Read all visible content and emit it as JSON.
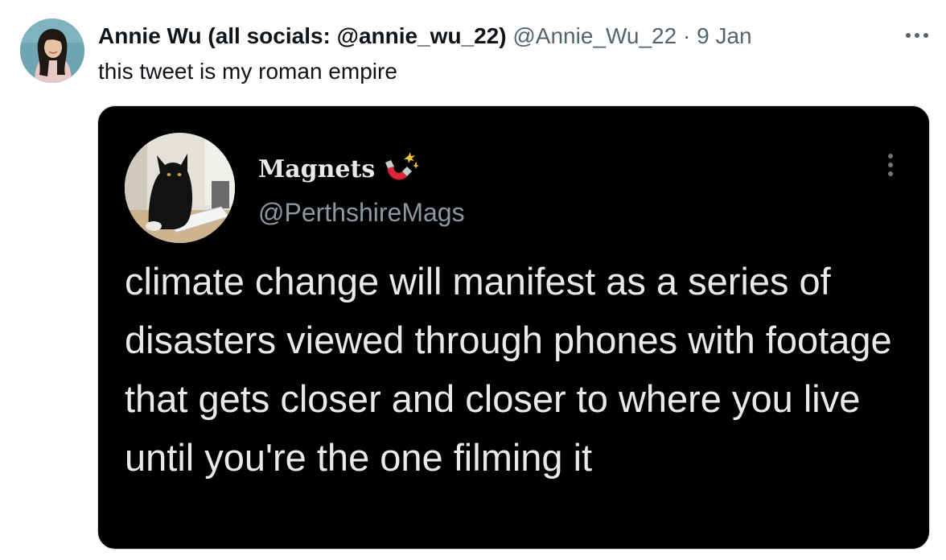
{
  "tweet": {
    "display_name": "Annie Wu (all socials: @annie_wu_22)",
    "handle": "@Annie_Wu_22",
    "separator": "·",
    "date": "9 Jan",
    "text": "this tweet is my roman empire",
    "more_icon": "more-horizontal-icon"
  },
  "quoted": {
    "display_name": "Magnets",
    "emoji_icon": "magnet-icon",
    "handle": "@PerthshireMags",
    "text": "climate change will manifest as a series of disasters viewed through phones with footage that gets closer and closer to where you live until you're the one filming it",
    "more_icon": "more-vertical-icon",
    "background_color": "#000000",
    "text_color": "#e7e9ea"
  }
}
